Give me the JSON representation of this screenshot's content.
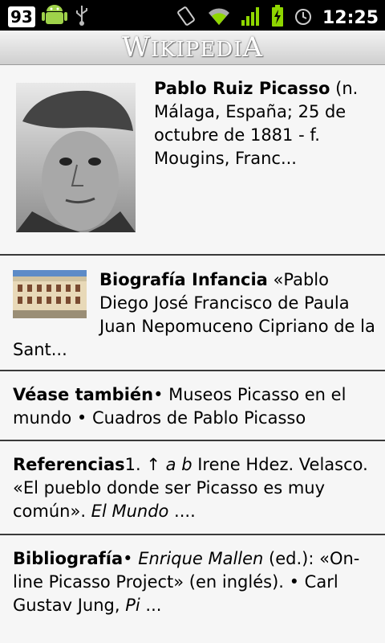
{
  "statusbar": {
    "notification_count": "93",
    "time": "12:25",
    "icons": [
      "android-icon",
      "usb-icon",
      "vibrate-icon",
      "wifi-icon",
      "signal-icon",
      "battery-charging-icon",
      "alarm-icon"
    ]
  },
  "header": {
    "logo_text": "Wikipedia"
  },
  "sections": [
    {
      "title": "Pablo Ruiz Picasso",
      "text": " (n. Málaga, España; 25 de octubre de 1881 - f. Mougins, Franc..."
    },
    {
      "title": "Biografía Infancia",
      "text": " «Pablo Diego José Francisco de Paula Juan Nepomuceno Cipriano de la Sant..."
    },
    {
      "title": "Véase también",
      "text": "• Museos Picasso en el mundo • Cuadros de Pablo Picasso"
    },
    {
      "title": "Referencias",
      "text_a": "1. ↑ ",
      "ital_a": "a b",
      "text_b": " Irene Hdez. Velasco. «El pueblo donde ser Picasso es muy común». ",
      "ital_b": "El Mundo",
      "text_c": " ...."
    },
    {
      "title": "Bibliografía",
      "text_a": "• ",
      "ital_a": "Enrique Mallen",
      "text_b": " (ed.): «On-line Picasso Project» (en inglés). • Carl Gustav Jung, ",
      "ital_b": "Pi",
      "text_c": " ..."
    }
  ]
}
